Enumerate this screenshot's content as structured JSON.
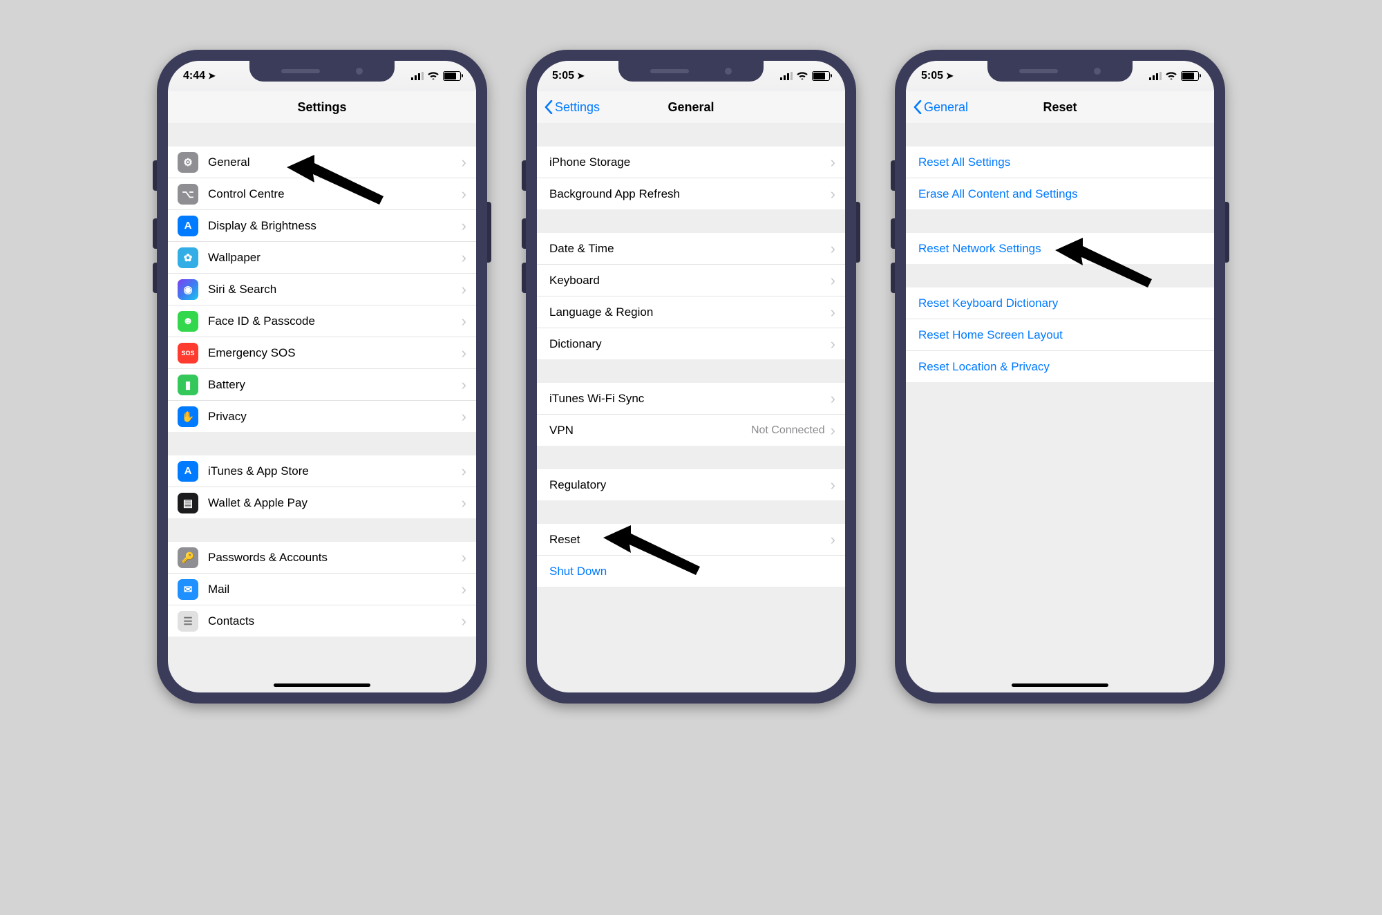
{
  "phones": {
    "p1": {
      "status": {
        "time": "4:44"
      },
      "nav": {
        "title": "Settings",
        "back": null
      },
      "sections": [
        {
          "gap": true
        },
        {
          "rows": [
            {
              "iconClass": "ic-general",
              "iconName": "gear-icon",
              "glyph": "⚙",
              "label": "General"
            },
            {
              "iconClass": "ic-control",
              "iconName": "switches-icon",
              "glyph": "⌥",
              "label": "Control Centre"
            },
            {
              "iconClass": "ic-display",
              "iconName": "textsize-icon",
              "glyph": "A",
              "label": "Display & Brightness"
            },
            {
              "iconClass": "ic-wallpaper",
              "iconName": "flower-icon",
              "glyph": "✿",
              "label": "Wallpaper"
            },
            {
              "iconClass": "ic-siri",
              "iconName": "siri-icon",
              "glyph": "◉",
              "label": "Siri & Search"
            },
            {
              "iconClass": "ic-faceid",
              "iconName": "faceid-icon",
              "glyph": "☻",
              "label": "Face ID & Passcode"
            },
            {
              "iconClass": "ic-sos",
              "iconName": "sos-icon",
              "glyph": "SOS",
              "label": "Emergency SOS",
              "small": true
            },
            {
              "iconClass": "ic-battery",
              "iconName": "battery-icon",
              "glyph": "▮",
              "label": "Battery"
            },
            {
              "iconClass": "ic-privacy",
              "iconName": "hand-icon",
              "glyph": "✋",
              "label": "Privacy"
            }
          ]
        },
        {
          "gap": true
        },
        {
          "rows": [
            {
              "iconClass": "ic-itunes",
              "iconName": "appstore-icon",
              "glyph": "A",
              "label": "iTunes & App Store"
            },
            {
              "iconClass": "ic-wallet",
              "iconName": "wallet-icon",
              "glyph": "▤",
              "label": "Wallet & Apple Pay"
            }
          ]
        },
        {
          "gap": true
        },
        {
          "rows": [
            {
              "iconClass": "ic-passwords",
              "iconName": "key-icon",
              "glyph": "🔑",
              "label": "Passwords & Accounts"
            },
            {
              "iconClass": "ic-mail",
              "iconName": "mail-icon",
              "glyph": "✉",
              "label": "Mail"
            },
            {
              "iconClass": "ic-contacts",
              "iconName": "contacts-icon",
              "glyph": "☰",
              "label": "Contacts"
            }
          ]
        }
      ]
    },
    "p2": {
      "status": {
        "time": "5:05"
      },
      "nav": {
        "title": "General",
        "back": "Settings"
      },
      "sections": [
        {
          "gap": true
        },
        {
          "rows": [
            {
              "label": "iPhone Storage"
            },
            {
              "label": "Background App Refresh"
            }
          ]
        },
        {
          "gap": true
        },
        {
          "rows": [
            {
              "label": "Date & Time"
            },
            {
              "label": "Keyboard"
            },
            {
              "label": "Language & Region"
            },
            {
              "label": "Dictionary"
            }
          ]
        },
        {
          "gap": true
        },
        {
          "rows": [
            {
              "label": "iTunes Wi-Fi Sync"
            },
            {
              "label": "VPN",
              "detail": "Not Connected"
            }
          ]
        },
        {
          "gap": true
        },
        {
          "rows": [
            {
              "label": "Regulatory"
            }
          ]
        },
        {
          "gap": true
        },
        {
          "rows": [
            {
              "label": "Reset"
            },
            {
              "label": "Shut Down",
              "blue": true,
              "noChevron": true
            }
          ]
        }
      ]
    },
    "p3": {
      "status": {
        "time": "5:05"
      },
      "nav": {
        "title": "Reset",
        "back": "General"
      },
      "sections": [
        {
          "gap": true
        },
        {
          "rows": [
            {
              "label": "Reset All Settings",
              "blue": true,
              "noChevron": true
            },
            {
              "label": "Erase All Content and Settings",
              "blue": true,
              "noChevron": true
            }
          ]
        },
        {
          "gap": true
        },
        {
          "rows": [
            {
              "label": "Reset Network Settings",
              "blue": true,
              "noChevron": true
            }
          ]
        },
        {
          "gap": true
        },
        {
          "rows": [
            {
              "label": "Reset Keyboard Dictionary",
              "blue": true,
              "noChevron": true
            },
            {
              "label": "Reset Home Screen Layout",
              "blue": true,
              "noChevron": true
            },
            {
              "label": "Reset Location & Privacy",
              "blue": true,
              "noChevron": true
            }
          ]
        }
      ]
    }
  },
  "arrows": {
    "a1": "points to General",
    "a2": "points to Reset",
    "a3": "points to Reset Network Settings"
  }
}
